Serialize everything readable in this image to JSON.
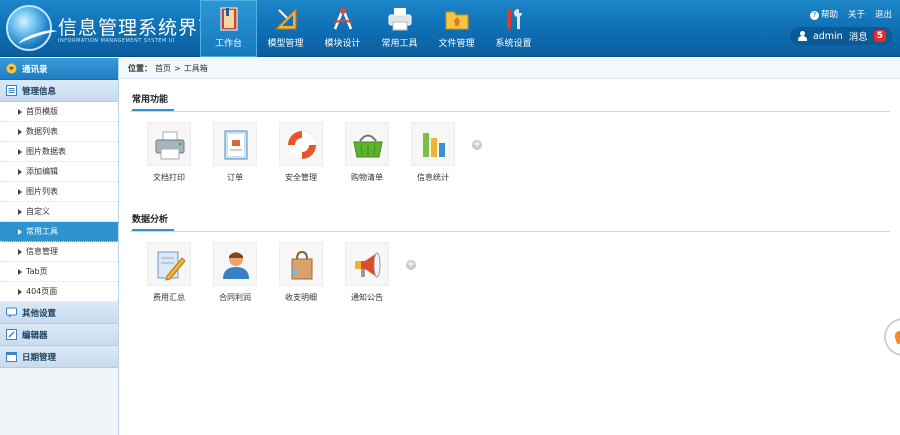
{
  "header": {
    "title": "信息管理系统界面",
    "subtitle": "INFORMATION MANAGEMENT SYSTEM UI",
    "nav": [
      {
        "label": "工作台",
        "icon": "workbench-icon"
      },
      {
        "label": "模型管理",
        "icon": "model-icon"
      },
      {
        "label": "模块设计",
        "icon": "module-icon"
      },
      {
        "label": "常用工具",
        "icon": "printer-icon"
      },
      {
        "label": "文件管理",
        "icon": "folder-icon"
      },
      {
        "label": "系统设置",
        "icon": "tools-icon"
      }
    ],
    "links": {
      "help": "帮助",
      "about": "关于",
      "logout": "退出"
    },
    "user": {
      "name": "admin",
      "messages_label": "消息",
      "messages_count": "5"
    }
  },
  "sidebar": {
    "top_label": "通讯录",
    "group_manage": "管理信息",
    "items": [
      "首页模版",
      "数据列表",
      "图片数据表",
      "添加编辑",
      "图片列表",
      "自定义",
      "常用工具",
      "信息管理",
      "Tab页",
      "404页面"
    ],
    "active_index": 6,
    "group_other": "其他设置",
    "group_editor": "编辑器",
    "group_date": "日期管理"
  },
  "breadcrumb": {
    "prefix": "位置：",
    "home": "首页",
    "sep": ">",
    "current": "工具箱"
  },
  "sections": [
    {
      "title": "常用功能",
      "tiles": [
        "文档打印",
        "订单",
        "安全管理",
        "购物清单",
        "信息统计"
      ]
    },
    {
      "title": "数据分析",
      "tiles": [
        "费用汇总",
        "合同利润",
        "收支明细",
        "通知公告"
      ]
    }
  ],
  "colors": {
    "primary": "#1877bd",
    "accent": "#2e93d1",
    "badge": "#e52b2b"
  }
}
